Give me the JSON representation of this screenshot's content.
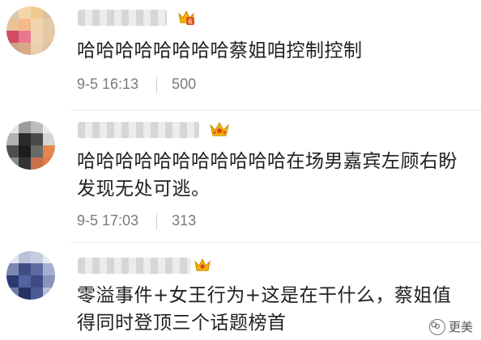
{
  "comments": [
    {
      "text": "哈哈哈哈哈哈哈哈蔡姐咱控制控制",
      "date": "9-5 16:13",
      "likes": "500",
      "badge": "crown-badge-6"
    },
    {
      "text": "哈哈哈哈哈哈哈哈哈哈哈在场男嘉宾左顾右盼发现无处可逃。",
      "date": "9-5 17:03",
      "likes": "313",
      "badge": "crown-badge"
    },
    {
      "text": "零溢事件+女王行为+这是在干什么，蔡姐值得同时登顶三个话题榜首",
      "badge": "crown-badge"
    }
  ],
  "watermark": {
    "label": "更美"
  },
  "colors": {
    "crown": "#f0b400",
    "crown_alt": "#e0551e",
    "text": "#1f1f1f",
    "meta": "#7a7a7a"
  }
}
